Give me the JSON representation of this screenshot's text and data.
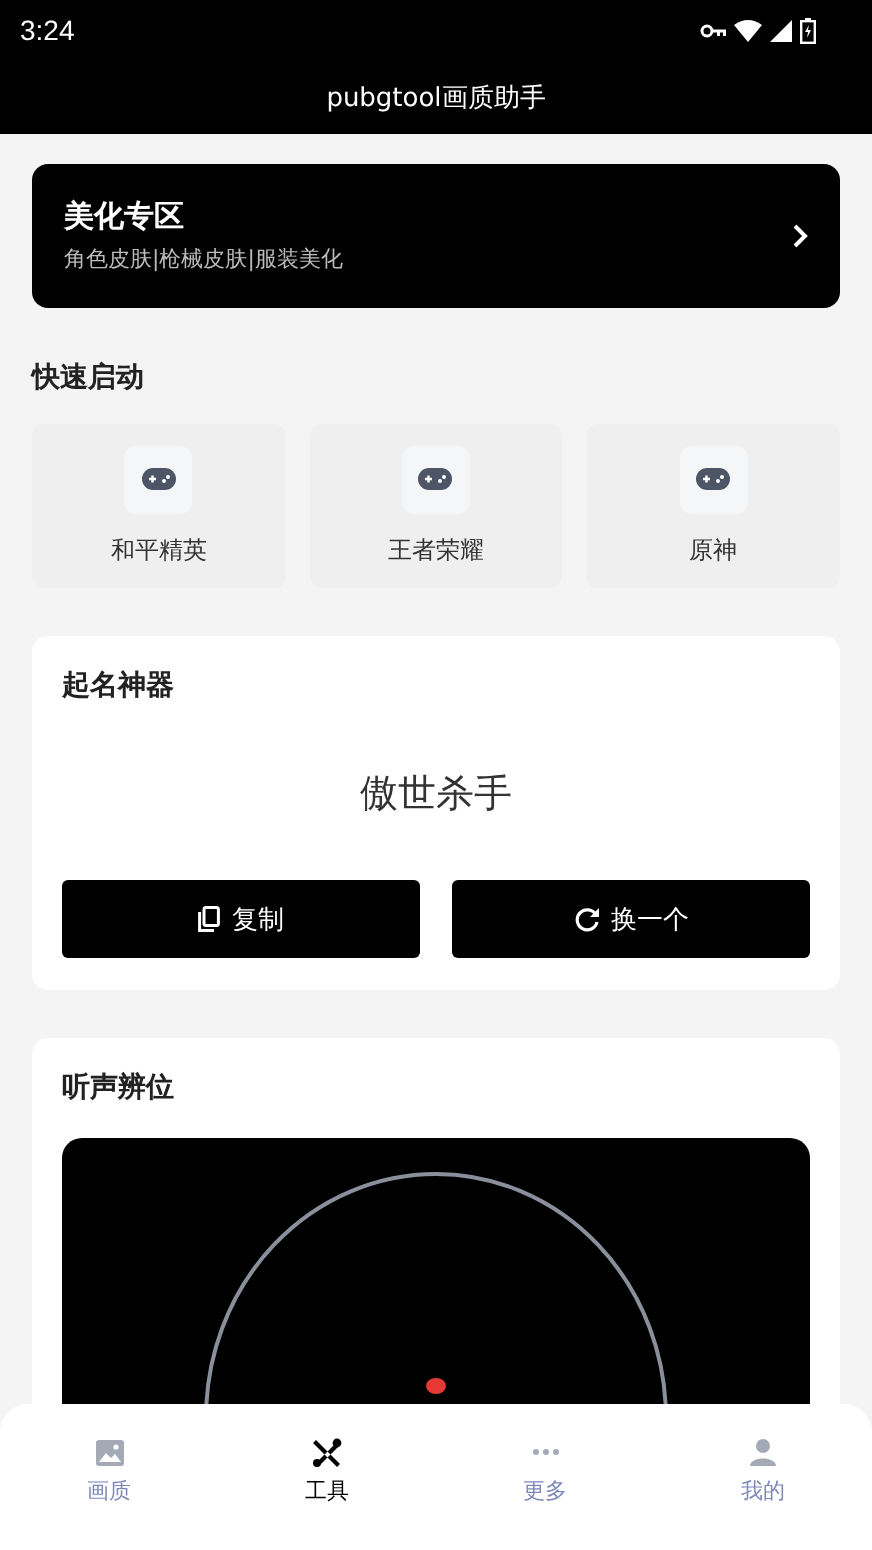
{
  "status_bar": {
    "time": "3:24"
  },
  "header": {
    "title": "pubgtool画质助手"
  },
  "banner": {
    "title": "美化专区",
    "subtitle": "角色皮肤|枪械皮肤|服装美化"
  },
  "quick_start": {
    "title": "快速启动",
    "items": [
      {
        "label": "和平精英"
      },
      {
        "label": "王者荣耀"
      },
      {
        "label": "原神"
      }
    ]
  },
  "name_generator": {
    "title": "起名神器",
    "name": "傲世杀手",
    "buttons": [
      {
        "kind": "copy",
        "label": "复制"
      },
      {
        "kind": "refresh",
        "label": "换一个"
      }
    ]
  },
  "sound_locator": {
    "title": "听声辨位"
  },
  "bottom_nav": [
    {
      "kind": "picture",
      "label": "画质",
      "selected": false
    },
    {
      "kind": "tools",
      "label": "工具",
      "selected": true
    },
    {
      "kind": "more",
      "label": "更多",
      "selected": false
    },
    {
      "kind": "user",
      "label": "我的",
      "selected": false
    }
  ]
}
